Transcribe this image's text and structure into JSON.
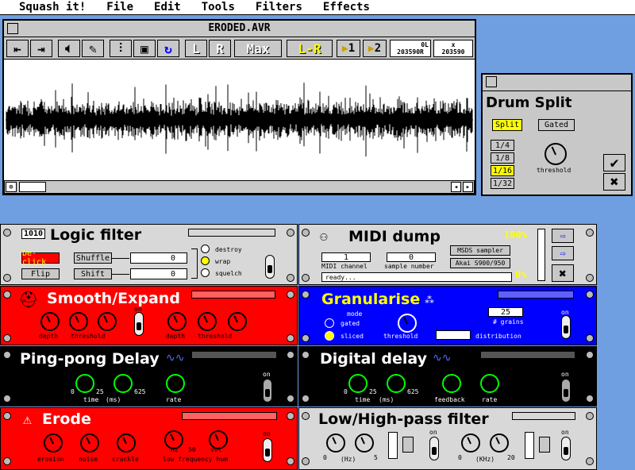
{
  "menu": [
    "Squash it!",
    "File",
    "Edit",
    "Tools",
    "Filters",
    "Effects"
  ],
  "editor": {
    "title": "ERODED.AVR",
    "toolbar": {
      "l": "L",
      "r": "R",
      "max": "Max",
      "lr": "L-R",
      "mark1": "1",
      "mark2": "2",
      "counter_a_top": "0",
      "counter_a_top_unit": "L",
      "counter_a_bot": "203590",
      "counter_a_bot_unit": "R",
      "counter_b_top": "x",
      "counter_b_bot": "203590"
    }
  },
  "drum_split": {
    "title": "Drum Split",
    "split": "Split",
    "gated": "Gated",
    "divisions": [
      "1/4",
      "1/8",
      "1/16",
      "1/32"
    ],
    "threshold": "threshold"
  },
  "logic_filter": {
    "title": "Logic filter",
    "logo": "1010",
    "declick": "De-click",
    "flip": "Flip",
    "shuffle": "Shuffle",
    "shift": "Shift",
    "val1": "0",
    "val2": "0",
    "options": [
      "destroy",
      "wrap",
      "squelch"
    ]
  },
  "midi_dump": {
    "title": "MIDI dump",
    "channel_val": "1",
    "sample_val": "0",
    "channel_label": "MIDI channel",
    "sample_label": "sample number",
    "sampler1": "MSDS sampler",
    "sampler2": "Akai S900/950",
    "status": "ready...",
    "pct_top": "100%",
    "pct_bot": "0%"
  },
  "smooth_expand": {
    "title": "Smooth/Expand",
    "lbl1": "depth",
    "lbl2": "threshold",
    "lbl3": "depth",
    "lbl4": "threshold",
    "on": "on"
  },
  "granularise": {
    "title": "Granularise",
    "mode": "mode",
    "gated": "gated",
    "sliced": "sliced",
    "threshold": "threshold",
    "grains_val": "25",
    "grains": "# grains",
    "distribution": "distribution",
    "on": "on"
  },
  "pingpong": {
    "title": "Ping-pong Delay",
    "time": "time",
    "ms": "(ms)",
    "rate": "rate",
    "t0": "0",
    "t25": "25",
    "t625": "625",
    "on": "on"
  },
  "digital_delay": {
    "title": "Digital delay",
    "time": "time",
    "ms": "(ms)",
    "feedback": "feedback",
    "rate": "rate",
    "t0": "0",
    "t25": "25",
    "t625": "625",
    "on": "on"
  },
  "erode": {
    "title": "Erode",
    "erosion": "erosion",
    "noise": "noise",
    "crackle": "crackle",
    "hz": "Hz",
    "fifty": "50",
    "vol": "vol",
    "hum": "low frequency hum",
    "on": "on"
  },
  "lowhigh": {
    "title": "Low/High-pass filter",
    "hz": "(Hz)",
    "khz": "(KHz)",
    "z0": "0",
    "z5": "5",
    "z20": "20",
    "on": "on"
  },
  "colors": {
    "desktop": "#6f9fe0",
    "red": "#ff0000",
    "blue": "#0000ff",
    "black": "#000000",
    "grey": "#c8c8c8",
    "yellow": "#ffff00"
  }
}
